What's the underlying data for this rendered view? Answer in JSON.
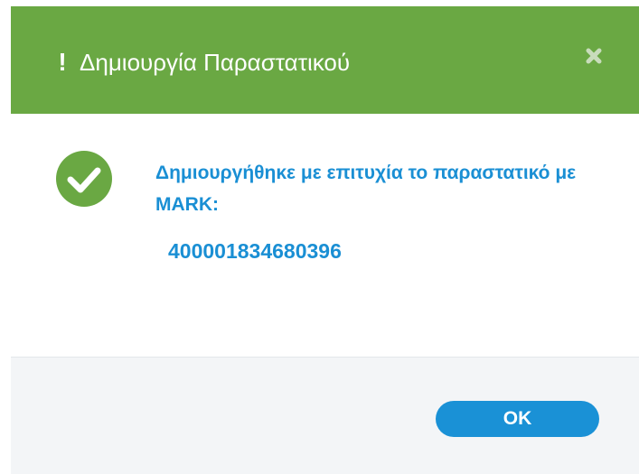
{
  "dialog": {
    "title": "Δημιουργία Παραστατικού",
    "title_icon": "exclamation-icon",
    "close_icon": "close-icon",
    "header_color": "#6aa843"
  },
  "content": {
    "status_icon": "check-circle-icon",
    "status_color": "#6aa843",
    "message": "Δημιουργήθηκε με επιτυχία το παραστατικό με MARK:",
    "mark": "400001834680396",
    "text_color": "#1a8fd4"
  },
  "footer": {
    "ok_label": "OK",
    "button_color": "#1a91d6"
  }
}
